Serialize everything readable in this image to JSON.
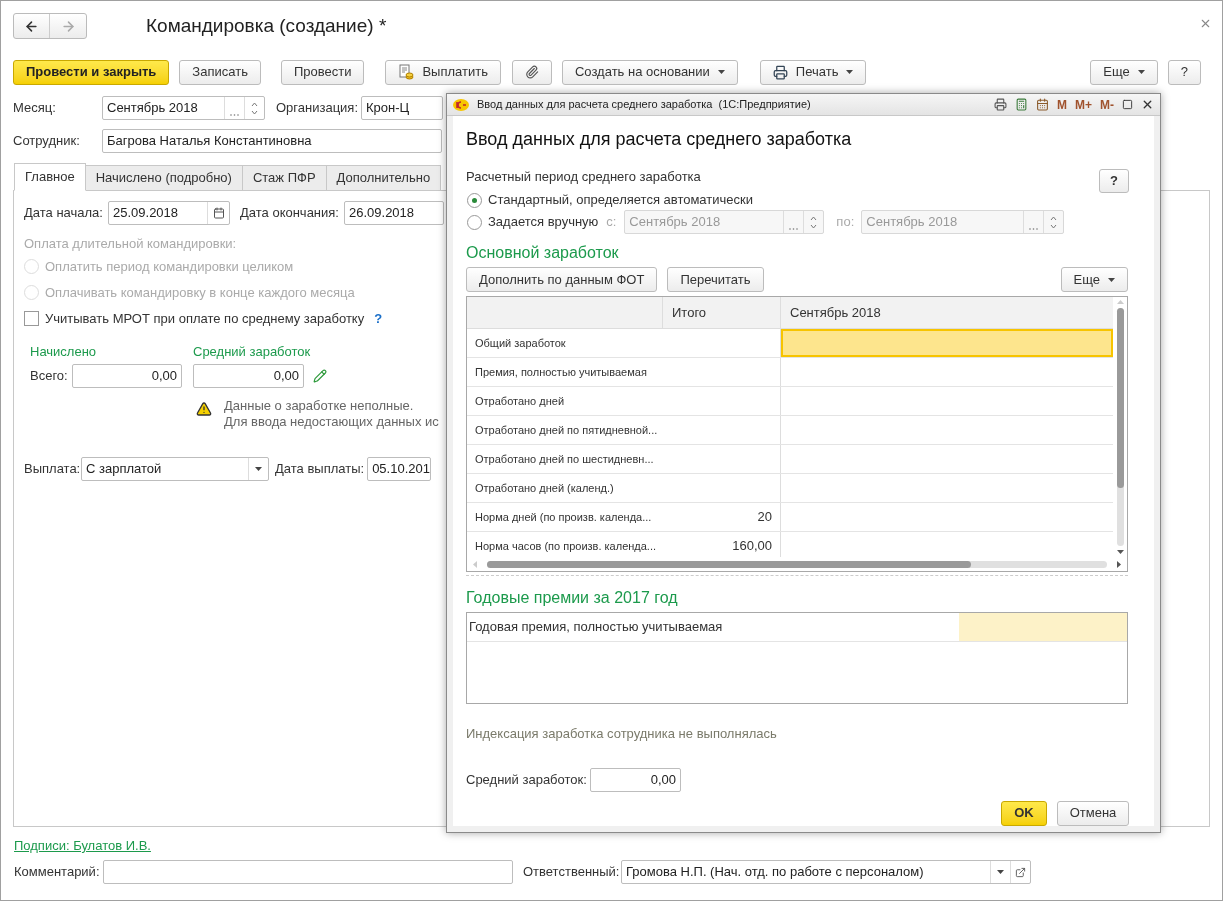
{
  "window": {
    "title": "Командировка (создание) *"
  },
  "toolbar": [
    {
      "label": "Провести и закрыть",
      "kind": "primary"
    },
    {
      "label": "Записать",
      "kind": "plain"
    },
    {
      "label": "Провести",
      "kind": "plain"
    },
    {
      "label": "Выплатить",
      "kind": "pay"
    },
    {
      "kind": "attach"
    },
    {
      "label": "Создать на основании",
      "kind": "menu"
    },
    {
      "label": "Печать",
      "kind": "print"
    }
  ],
  "toolbar_right": [
    {
      "label": "Еще",
      "kind": "menu"
    },
    {
      "label": "?",
      "kind": "plain"
    }
  ],
  "month": {
    "label": "Месяц:",
    "value": "Сентябрь 2018"
  },
  "organization": {
    "label": "Организация:",
    "value": "Крон-Ц"
  },
  "employee": {
    "label": "Сотрудник:",
    "value": "Багрова Наталья Константиновна"
  },
  "tabs": [
    {
      "label": "Главное",
      "selected": true
    },
    {
      "label": "Начислено (подробно)",
      "selected": false
    },
    {
      "label": "Стаж ПФР",
      "selected": false
    },
    {
      "label": "Дополнительно",
      "selected": false
    }
  ],
  "start_date": {
    "label": "Дата начала:",
    "value": "25.09.2018"
  },
  "end_date": {
    "label": "Дата окончания:",
    "value": "26.09.2018"
  },
  "long_trip": {
    "label": "Оплата длительной командировки:",
    "disabled": true,
    "options": [
      {
        "label": "Оплатить период командировки целиком",
        "selected": false
      },
      {
        "label": "Оплачивать командировку в конце каждого месяца",
        "selected": false
      }
    ]
  },
  "mrot": {
    "label": "Учитывать МРОТ при оплате по среднему заработку",
    "checked": false,
    "help": "?"
  },
  "accrued": {
    "title": "Начислено",
    "label": "Всего:",
    "value": "0,00"
  },
  "average": {
    "title": "Средний заработок",
    "value": "0,00"
  },
  "warning": [
    "Данные о заработке неполные.",
    "Для ввода недостающих данных ис"
  ],
  "payment": {
    "label": "Выплата:",
    "value": "С зарплатой"
  },
  "payment_date": {
    "label": "Дата выплаты:",
    "value": "05.10.201"
  },
  "signatures": "Подписи: Булатов И.В.",
  "comment": {
    "label": "Комментарий:"
  },
  "responsible": {
    "label": "Ответственный:",
    "value": "Громова Н.П. (Нач. отд. по работе с персоналом)"
  },
  "dialog": {
    "title": "Ввод данных для расчета среднего заработка  (1С:Предприятие)",
    "memory_buttons": [
      "M",
      "M+",
      "M-"
    ],
    "heading": "Ввод данных для расчета среднего заработка",
    "period_label": "Расчетный период среднего заработка",
    "help": "?",
    "period_options": [
      {
        "label": "Стандартный, определяется автоматически",
        "selected": true
      },
      {
        "label": "Задается вручную",
        "selected": false
      }
    ],
    "period_from": {
      "label": "с:",
      "value": "Сентябрь 2018"
    },
    "period_to": {
      "label": "по:",
      "value": "Сентябрь 2018"
    },
    "section": "Основной заработок",
    "buttons": [
      "Дополнить по данным ФОТ",
      "Перечитать"
    ],
    "more": "Еще",
    "columns": [
      "Итого",
      "Сентябрь 2018"
    ],
    "rows": [
      {
        "label": "Общий заработок",
        "selected": true
      },
      {
        "label": "Премия, полностью учитываемая",
        "selected": false
      },
      {
        "label": "Отработано дней",
        "selected": false
      },
      {
        "label": "Отработано дней по пятидневной...",
        "selected": false
      },
      {
        "label": "Отработано дней по шестидневн...",
        "selected": false
      },
      {
        "label": "Отработано дней (календ.)",
        "selected": false
      },
      {
        "label": "Норма дней (по произв. календа...",
        "total": "20",
        "selected": false
      },
      {
        "label": "Норма часов (по произв. календа...",
        "total": "160,00",
        "selected": false
      }
    ],
    "bonus_title": "Годовые премии за 2017 год",
    "bonus_rows": [
      {
        "label": "Годовая премия, полностью учитываемая"
      }
    ],
    "indexation": "Индексация заработка сотрудника не выполнялась",
    "average": {
      "label": "Средний заработок:",
      "value": "0,00"
    },
    "ok": "OK",
    "cancel": "Отмена"
  }
}
